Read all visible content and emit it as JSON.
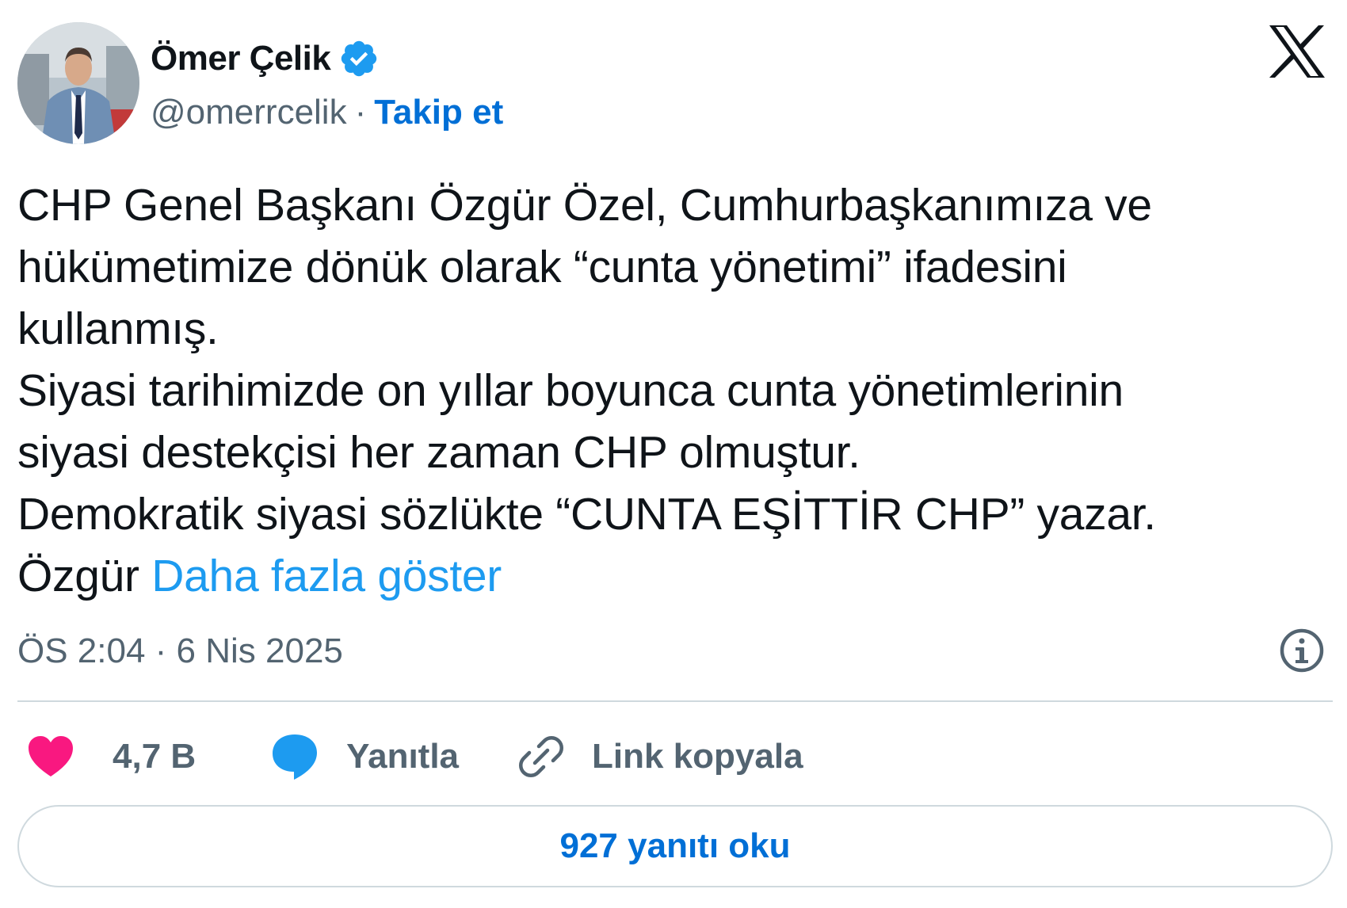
{
  "author": {
    "name": "Ömer Çelik",
    "handle": "@omerrcelik",
    "separator": "·",
    "follow_label": "Takip et",
    "verified": true
  },
  "tweet": {
    "lines": [
      "CHP Genel Başkanı Özgür Özel, Cumhurbaşkanımıza ve",
      "hükümetimize dönük olarak “cunta yönetimi” ifadesini",
      "kullanmış.",
      "Siyasi tarihimizde on yıllar boyunca cunta yönetimlerinin",
      "siyasi destekçisi her zaman CHP olmuştur.",
      "Demokratik siyasi sözlükte “CUNTA EŞİTTİR CHP” yazar."
    ],
    "last_line": "Özgür",
    "more_label": "Daha fazla göster",
    "timestamp": "ÖS 2:04 · 6 Nis 2025"
  },
  "actions": {
    "like_count": "4,7 B",
    "reply_label": "Yanıtla",
    "copy_link_label": "Link kopyala"
  },
  "replies_button_label": "927 yanıtı oku",
  "icons": {
    "verified": "verified-badge-icon",
    "platform": "x-logo-icon",
    "info": "info-icon",
    "like": "heart-icon",
    "reply": "speech-bubble-icon",
    "link": "link-icon"
  },
  "colors": {
    "text": "#0f1419",
    "muted": "#536471",
    "link": "#1d9bf0",
    "follow": "#006fd6",
    "heart": "#f91880",
    "reply_icon": "#1d9bf0",
    "border": "#cfd9de"
  }
}
